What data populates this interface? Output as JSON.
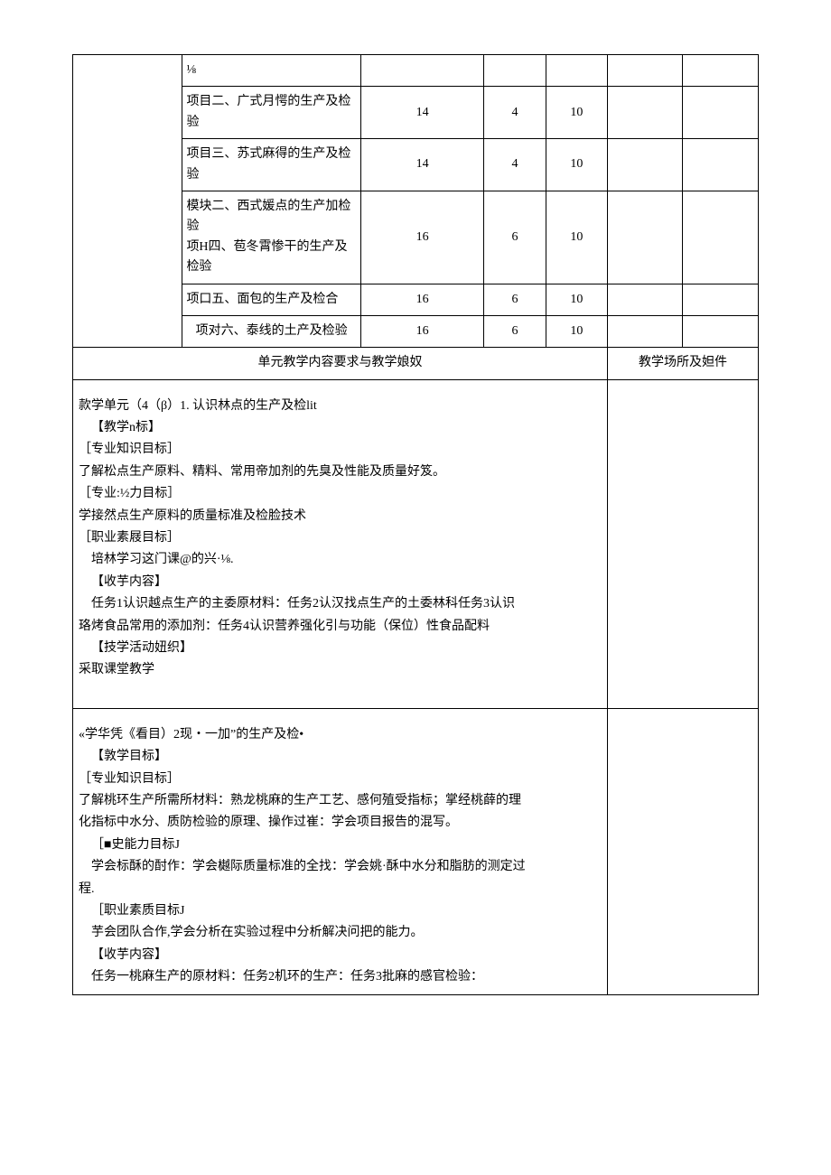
{
  "rows": [
    {
      "c2": "⅛",
      "c3": "",
      "c4": "",
      "c5": "",
      "c6": "",
      "c7": ""
    },
    {
      "c2": "项目二、广式月愕的生产及检验",
      "c3": "14",
      "c4": "4",
      "c5": "10",
      "c6": "",
      "c7": ""
    },
    {
      "c2": "项目三、苏式麻得的生产及检验",
      "c3": "14",
      "c4": "4",
      "c5": "10",
      "c6": "",
      "c7": ""
    },
    {
      "c2": "模块二、西式媛点的生产加检验\n项H四、苞冬霄惨干的生产及检验",
      "c3": "16",
      "c4": "6",
      "c5": "10",
      "c6": "",
      "c7": ""
    },
    {
      "c2": "项口五、面包的生产及检合",
      "c3": "16",
      "c4": "6",
      "c5": "10",
      "c6": "",
      "c7": ""
    },
    {
      "c2": "项对六、泰线的土产及检验",
      "c3": "16",
      "c4": "6",
      "c5": "10",
      "c6": "",
      "c7": ""
    }
  ],
  "section_header": {
    "left": "单元教学内容要求与教学娘奴",
    "right": "教学场所及妲件"
  },
  "unit1": {
    "title": "款学单元（4（β）1. 认识林点的生产及检lit",
    "goals_hdr": "【教学n标】",
    "zszk_hdr": "［专业知识目标］",
    "zszk_body": "了解松点生产原料、精料、常用帝加剂的先臭及性能及质量好笈。",
    "zynl_hdr": "［专业:½力目标］",
    "zynl_body": "学接然点生产原料的质量标准及检脸技术",
    "zysz_hdr": "［职业素屐目标］",
    "zysz_body": "培林学习这门课@的兴·⅛.",
    "content_hdr": "【收芋内容】",
    "content_l1": "任务1认识越点生产的主委原材料：任务2认汉找点生产的土委林科任务3认识",
    "content_l2": "珞烤食品常用的添加剂：任务4认识营养强化引与功能（保位）性食品配料",
    "act_hdr": "【技学活动妞织】",
    "act_body": "采取课堂教学"
  },
  "unit2": {
    "title": "«学华凭《看目）2现・一加”的生产及检•",
    "goals_hdr": "【敦学目标】",
    "zszk_hdr": "［专业知识目标］",
    "zszk_l1": "了解桃环生产所需所材料：熟龙桃麻的生产工艺、感何殖受指标；掌经桃薛的理",
    "zszk_l2": "化指标中水分、质防检验的原理、操作过崔：学会项目报告的混写。",
    "zynl_hdr": "［■史能力目标J",
    "zynl_l1": "学会标酥的酎作：学会樾际质量标准的全找：学会姚·酥中水分和脂肪的测定过",
    "zynl_l2": "程.",
    "zysz_hdr": "［职业素质目标J",
    "zysz_body": "芋会团队合作,学会分析在实验过程中分析解决问把的能力。",
    "content_hdr": "【收芋内容】",
    "content_l1": "任务一桃麻生产的原材料：任务2机环的生产：任务3批麻的感官检验："
  }
}
